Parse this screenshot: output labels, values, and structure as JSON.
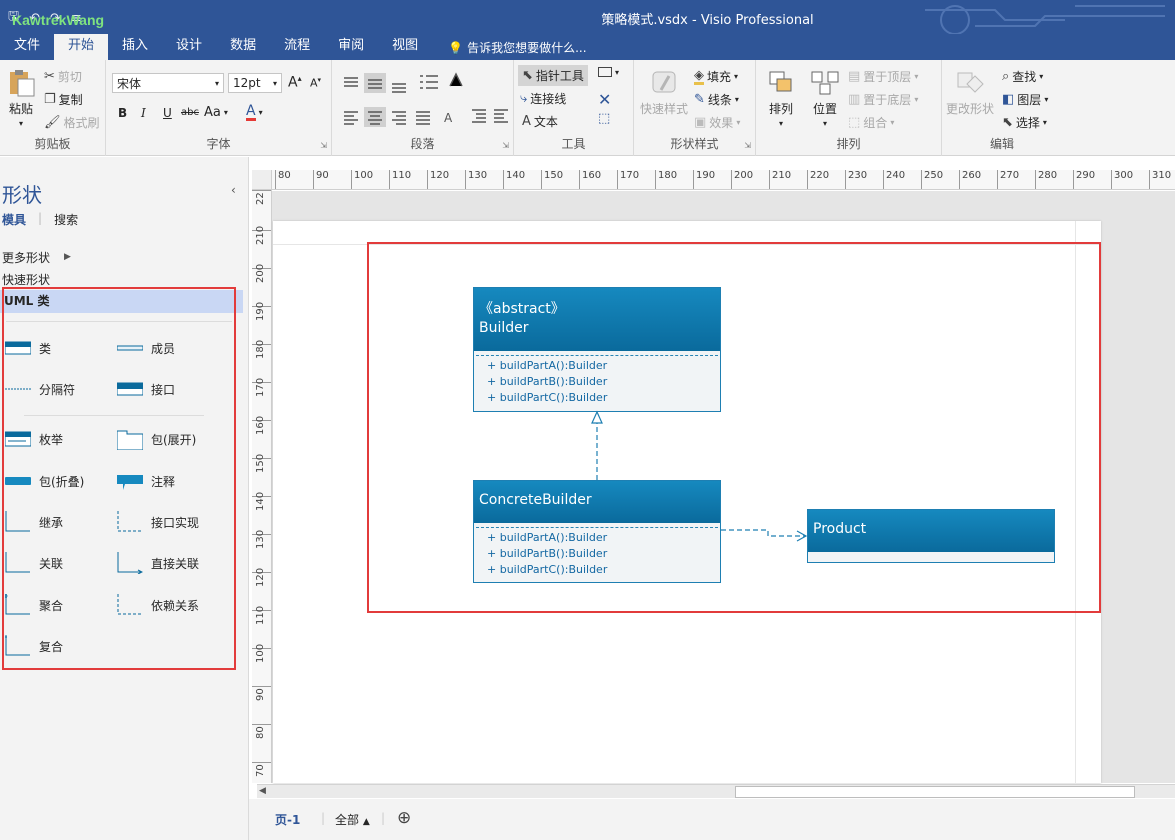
{
  "titlebar": {
    "title": "策略模式.vsdx - Visio Professional",
    "watermark": "KawtrekWang",
    "qat": [
      "save-icon",
      "undo-icon",
      "redo-icon",
      "customize-icon"
    ]
  },
  "tabs": [
    "文件",
    "开始",
    "插入",
    "设计",
    "数据",
    "流程",
    "审阅",
    "视图"
  ],
  "active_tab": "开始",
  "tell_me": "告诉我您想要做什么...",
  "ribbon": {
    "clipboard": {
      "paste": "粘贴",
      "cut": "剪切",
      "copy": "复制",
      "format_painter": "格式刷",
      "label": "剪贴板"
    },
    "font": {
      "family": "宋体",
      "size": "12pt",
      "aa": "Aa",
      "label": "字体"
    },
    "paragraph": {
      "label": "段落"
    },
    "tools": {
      "pointer": "指针工具",
      "connector": "连接线",
      "text": "文本",
      "label": "工具"
    },
    "shape_styles": {
      "quick_styles": "快速样式",
      "fill": "填充",
      "line": "线条",
      "effects": "效果",
      "label": "形状样式"
    },
    "arrange": {
      "arrange": "排列",
      "position": "位置",
      "bring_front": "置于顶层",
      "send_back": "置于底层",
      "group": "组合",
      "label": "排列"
    },
    "editing": {
      "change_shape": "更改形状",
      "find": "查找",
      "layers": "图层",
      "select": "选择",
      "label": "编辑"
    }
  },
  "shapes_pane": {
    "title": "形状",
    "tab_stencils": "模具",
    "tab_search": "搜索",
    "more_shapes": "更多形状",
    "quick_shapes": "快速形状",
    "stencil": "UML 类",
    "items": [
      {
        "label": "类"
      },
      {
        "label": "成员"
      },
      {
        "label": "分隔符"
      },
      {
        "label": "接口"
      },
      {
        "label": "枚举"
      },
      {
        "label": "包(展开)"
      },
      {
        "label": "包(折叠)"
      },
      {
        "label": "注释"
      },
      {
        "label": "继承"
      },
      {
        "label": "接口实现"
      },
      {
        "label": "关联"
      },
      {
        "label": "直接关联"
      },
      {
        "label": "聚合"
      },
      {
        "label": "依赖关系"
      },
      {
        "label": "复合"
      }
    ]
  },
  "ruler": {
    "h": [
      "80",
      "90",
      "100",
      "110",
      "120",
      "130",
      "140",
      "150",
      "160",
      "170",
      "180",
      "190",
      "200",
      "210",
      "220",
      "230",
      "240",
      "250",
      "260",
      "270",
      "280",
      "290",
      "300",
      "310"
    ],
    "v": [
      "22",
      "210",
      "200",
      "190",
      "180",
      "170",
      "160",
      "150",
      "140",
      "130",
      "120",
      "110",
      "100",
      "90",
      "80",
      "70"
    ]
  },
  "diagram": {
    "builder": {
      "stereotype": "《abstract》",
      "name": "Builder",
      "ops": [
        "+ buildPartA():Builder",
        "+ buildPartB():Builder",
        "+ buildPartC():Builder"
      ]
    },
    "concrete": {
      "name": "ConcreteBuilder",
      "ops": [
        "+ buildPartA():Builder",
        "+ buildPartB():Builder",
        "+ buildPartC():Builder"
      ]
    },
    "product": {
      "name": "Product"
    }
  },
  "pagebar": {
    "page": "页-1",
    "all": "全部",
    "all_arrow": "▲",
    "add_page": "⊕"
  },
  "colors": {
    "accent": "#2f5597",
    "uml_header": "#0a6a9c",
    "selection": "#e23b3b"
  }
}
